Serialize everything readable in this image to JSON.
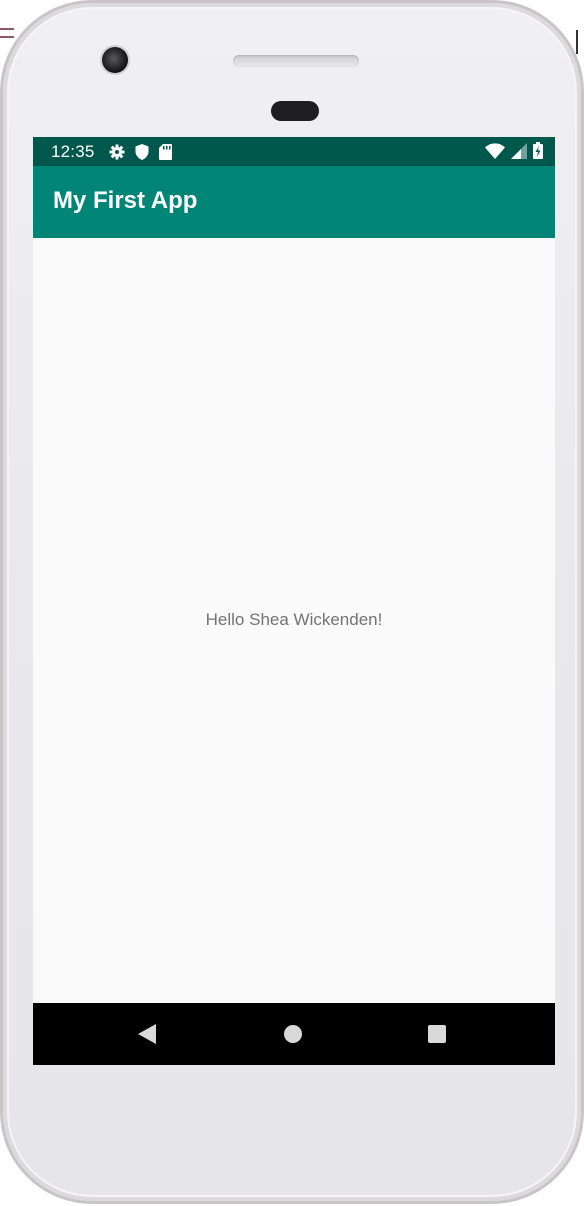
{
  "status_bar": {
    "time": "12:35",
    "icons_left": [
      "settings-gear-icon",
      "shield-icon",
      "sd-card-icon"
    ],
    "icons_right": [
      "wifi-icon",
      "signal-icon",
      "battery-charging-icon"
    ]
  },
  "app_bar": {
    "title": "My First App",
    "color": "#008577",
    "status_color": "#00574b"
  },
  "main": {
    "message": "Hello Shea Wickenden!"
  },
  "nav_bar": {
    "buttons": [
      "back-icon",
      "home-icon",
      "recents-icon"
    ]
  }
}
